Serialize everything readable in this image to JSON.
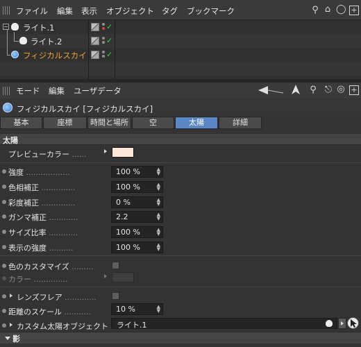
{
  "object_manager": {
    "menu": [
      "ファイル",
      "編集",
      "表示",
      "オブジェクト",
      "タグ",
      "ブックマーク"
    ],
    "objects": [
      {
        "name": "ライト.1",
        "color": "#e6e6e6"
      },
      {
        "name": "ライト.2",
        "color": "#e6e6e6"
      },
      {
        "name": "フィジカルスカイ",
        "color": "#f0a030"
      }
    ]
  },
  "attribute_manager": {
    "menu": [
      "モード",
      "編集",
      "ユーザデータ"
    ],
    "title": "フィジカルスカイ [フィジカルスカイ]",
    "tabs": [
      "基本",
      "座標",
      "時間と場所",
      "空",
      "太陽",
      "詳細"
    ],
    "active_tab": "太陽",
    "section": "太陽",
    "preview_color": {
      "label": "プレビューカラー",
      "color": "#ffe6d6"
    },
    "params": [
      {
        "label": "強度",
        "value": "100 %"
      },
      {
        "label": "色相補正",
        "value": "100 %"
      },
      {
        "label": "彩度補正",
        "value": "0 %"
      },
      {
        "label": "ガンマ補正",
        "value": "2.2"
      },
      {
        "label": "サイズ比率",
        "value": "100 %"
      },
      {
        "label": "表示の強度",
        "value": "100 %"
      }
    ],
    "color_customize": {
      "label": "色のカスタマイズ",
      "checked": false
    },
    "color": {
      "label": "カラー"
    },
    "lens_flare": {
      "label": "レンズフレア",
      "checked": false
    },
    "distance_scale": {
      "label": "距離のスケール",
      "value": "10 %"
    },
    "custom_sun": {
      "label": "カスタム太陽オブジェクト",
      "value": "ライト.1"
    },
    "shadow_section": "影"
  }
}
